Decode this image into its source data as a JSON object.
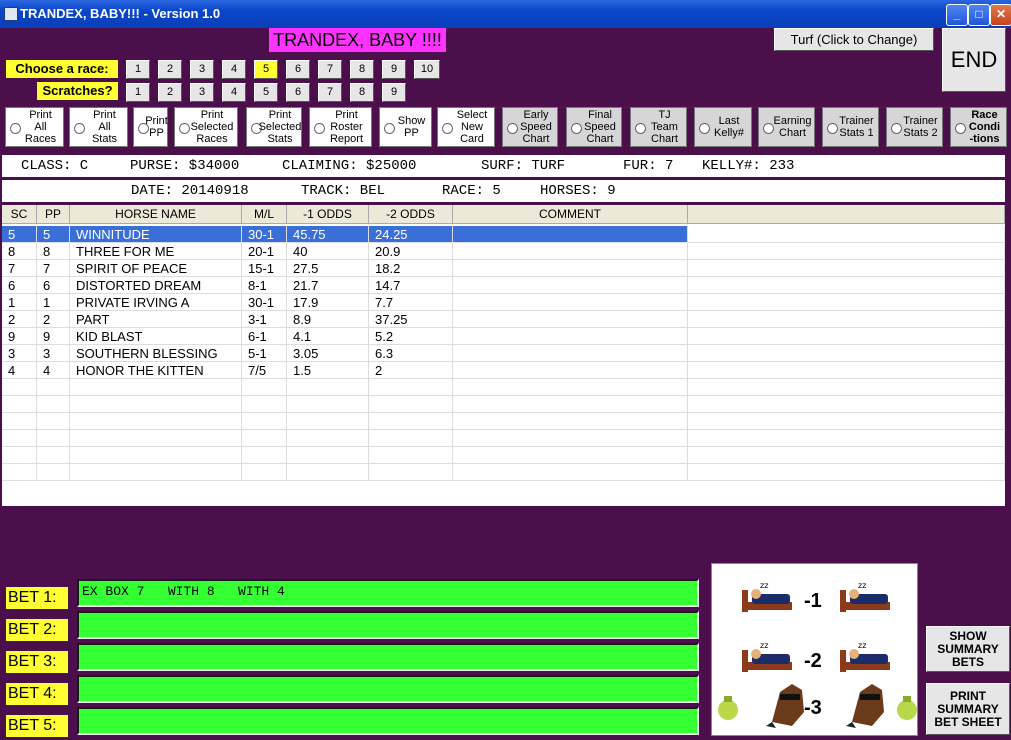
{
  "window": {
    "title": "TRANDEX, BABY!!! - Version 1.0"
  },
  "banner": "TRANDEX, BABY !!!!",
  "turf_button": "Turf (Click to Change)",
  "end_button": "END",
  "choose_race": {
    "label": "Choose  a race:",
    "races": [
      "1",
      "2",
      "3",
      "4",
      "5",
      "6",
      "7",
      "8",
      "9",
      "10"
    ],
    "selected": "5"
  },
  "scratches": {
    "label": "Scratches?",
    "items": [
      "1",
      "2",
      "3",
      "4",
      "5",
      "6",
      "7",
      "8",
      "9"
    ]
  },
  "options": [
    {
      "label": "Print\nAll\nRaces",
      "style": "white"
    },
    {
      "label": "Print\nAll\nStats",
      "style": "white"
    },
    {
      "label": "Print\nPP",
      "style": "white"
    },
    {
      "label": "Print\nSelected\nRaces",
      "style": "white"
    },
    {
      "label": "Print\nSelected\nStats",
      "style": "white"
    },
    {
      "label": "Print\nRoster\nReport",
      "style": "white"
    },
    {
      "label": "Show\nPP",
      "style": "white"
    },
    {
      "label": "Select\nNew\nCard",
      "style": "white"
    },
    {
      "label": "Early\nSpeed\nChart",
      "style": "grey"
    },
    {
      "label": "Final\nSpeed\nChart",
      "style": "grey"
    },
    {
      "label": "TJ\nTeam\nChart",
      "style": "grey"
    },
    {
      "label": "Last\nKelly#",
      "style": "grey"
    },
    {
      "label": "Earning\nChart",
      "style": "grey"
    },
    {
      "label": "Trainer\nStats 1",
      "style": "grey"
    },
    {
      "label": "Trainer\nStats 2",
      "style": "grey"
    },
    {
      "label": "Race\nCondi\n-tions",
      "style": "grey-bold"
    }
  ],
  "info": {
    "class": "CLASS: C",
    "purse": "PURSE: $34000",
    "claiming": "CLAIMING: $25000",
    "surf": "SURF: TURF",
    "fur": "FUR: 7",
    "kelly": "KELLY#: 233",
    "date": "DATE: 20140918",
    "track": "TRACK: BEL",
    "race": "RACE: 5",
    "horses": "HORSES: 9"
  },
  "table": {
    "columns": [
      "SC",
      "PP",
      "HORSE NAME",
      "M/L",
      "-1 ODDS",
      "-2 ODDS",
      "COMMENT"
    ],
    "rows": [
      [
        "5",
        "5",
        "WINNITUDE",
        "30-1",
        "45.75",
        "24.25",
        ""
      ],
      [
        "8",
        "8",
        "THREE FOR ME",
        "20-1",
        "40",
        "20.9",
        ""
      ],
      [
        "7",
        "7",
        "SPIRIT OF PEACE",
        "15-1",
        "27.5",
        "18.2",
        ""
      ],
      [
        "6",
        "6",
        "DISTORTED DREAM",
        "8-1",
        "21.7",
        "14.7",
        ""
      ],
      [
        "1",
        "1",
        "PRIVATE IRVING A",
        "30-1",
        "17.9",
        "7.7",
        ""
      ],
      [
        "2",
        "2",
        "PART",
        "3-1",
        "8.9",
        "37.25",
        ""
      ],
      [
        "9",
        "9",
        "KID BLAST",
        "6-1",
        "4.1",
        "5.2",
        ""
      ],
      [
        "3",
        "3",
        "SOUTHERN BLESSING",
        "5-1",
        "3.05",
        "6.3",
        ""
      ],
      [
        "4",
        "4",
        "HONOR THE KITTEN",
        "7/5",
        "1.5",
        "2",
        ""
      ]
    ],
    "selected_row": 0
  },
  "bets": [
    {
      "label": "BET 1:",
      "value": "EX BOX 7   WITH 8   WITH 4"
    },
    {
      "label": "BET 2:",
      "value": ""
    },
    {
      "label": "BET 3:",
      "value": ""
    },
    {
      "label": "BET 4:",
      "value": ""
    },
    {
      "label": "BET 5:",
      "value": ""
    }
  ],
  "legend": {
    "row1": "-1",
    "row2": "-2",
    "row3": "-3"
  },
  "show_summary": "SHOW\nSUMMARY\nBETS",
  "print_summary": "PRINT\nSUMMARY\nBET SHEET",
  "colors": {
    "background": "#4b0f4b",
    "highlight": "#ffff33",
    "banner": "#ff33ff",
    "bet_field": "#33ff33",
    "selection": "#3a6fd8"
  }
}
